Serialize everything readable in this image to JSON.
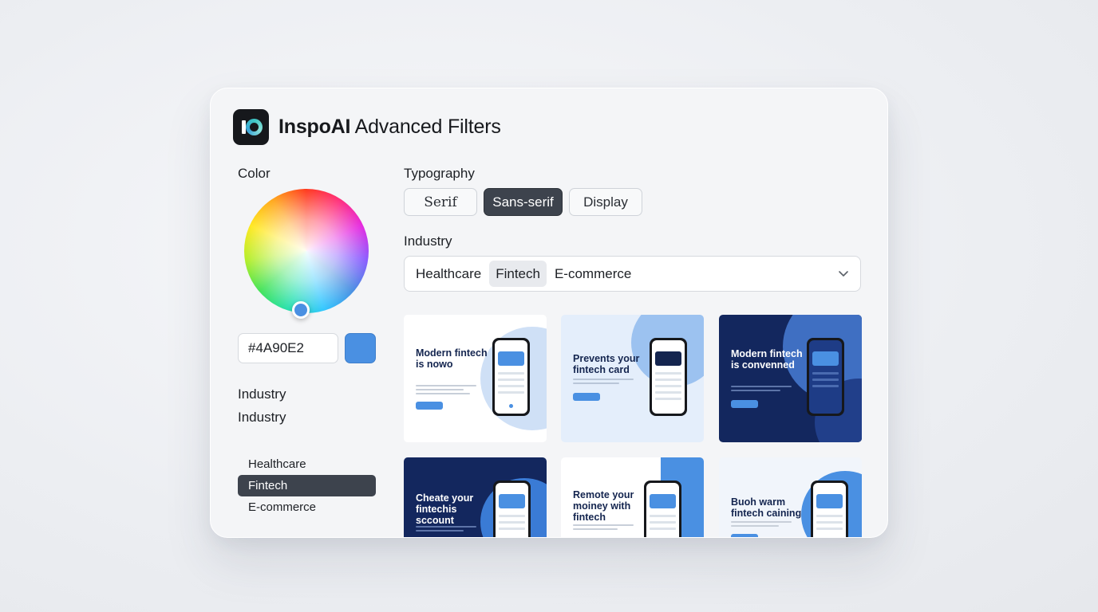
{
  "app": {
    "brand": "InspoAI",
    "title_rest": " Advanced Filters"
  },
  "color": {
    "label": "Color",
    "hex_value": "#4A90E2",
    "swatch_color": "#4A90E2"
  },
  "sidebar": {
    "label1": "Industry",
    "label2": "Industry",
    "items": [
      {
        "label": "Healthcare",
        "active": false
      },
      {
        "label": "Fintech",
        "active": true
      },
      {
        "label": "E-commerce",
        "active": false
      }
    ]
  },
  "typography": {
    "label": "Typography",
    "options": [
      {
        "label": "Serif",
        "selected": false
      },
      {
        "label": "Sans-serif",
        "selected": true
      },
      {
        "label": "Display",
        "selected": false
      }
    ]
  },
  "industry": {
    "label": "Industry",
    "chips": [
      {
        "label": "Healthcare",
        "active": false
      },
      {
        "label": "Fintech",
        "active": true
      },
      {
        "label": "E-commerce",
        "active": false
      }
    ]
  },
  "results": [
    {
      "heading": "Modern fintech is nowo",
      "theme": "light"
    },
    {
      "heading": "Prevents your fintech card",
      "theme": "pale"
    },
    {
      "heading": "Modern fintech is convenned",
      "theme": "dark"
    },
    {
      "heading": "Cheate your fintechis sccount",
      "theme": "dark"
    },
    {
      "heading": "Remote your moiney with fintech",
      "theme": "light-split"
    },
    {
      "heading": "Buoh warm fintech caining",
      "theme": "light"
    }
  ],
  "colors": {
    "accent": "#4A90E2",
    "selected_dark": "#3D434D",
    "card_dark": "#13275e"
  }
}
